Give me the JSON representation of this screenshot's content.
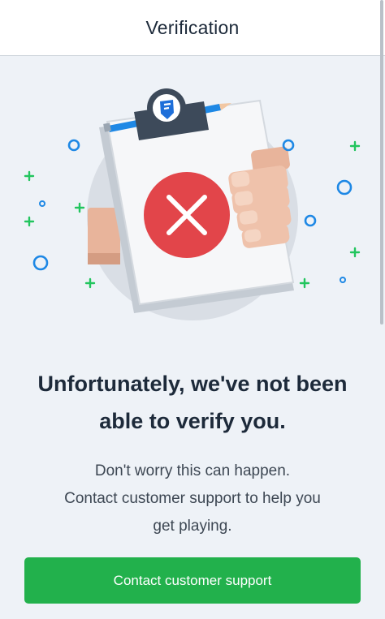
{
  "header": {
    "title": "Verification"
  },
  "illustration": {
    "badge_icon": "fanduel-shield-logo",
    "status_icon": "close-x-icon",
    "colors": {
      "status": "#e2454a",
      "sparkle_green": "#22c55e",
      "sparkle_blue": "#1e88e5"
    }
  },
  "message": {
    "headline_line1": "Unfortunately, we've not been",
    "headline_line2": "able to verify you.",
    "body_line1": "Don't worry this can happen.",
    "body_line2": "Contact customer support to help you",
    "body_line3": "get playing."
  },
  "cta": {
    "label": "Contact customer support",
    "color": "#22b14c"
  }
}
